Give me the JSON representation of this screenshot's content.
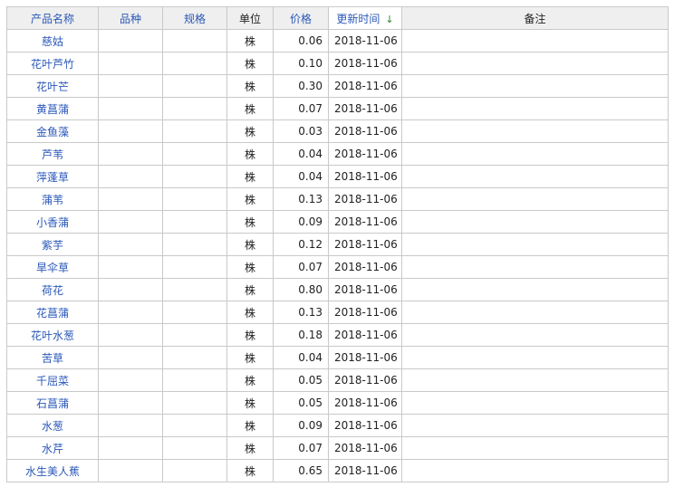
{
  "columns": {
    "name": "产品名称",
    "variety": "品种",
    "spec": "规格",
    "unit": "单位",
    "price": "价格",
    "updated": "更新时间",
    "note": "备注"
  },
  "sort_icon": "arrow-down-icon",
  "rows": [
    {
      "name": "慈姑",
      "variety": "",
      "spec": "",
      "unit": "株",
      "price": "0.06",
      "updated": "2018-11-06",
      "note": ""
    },
    {
      "name": "花叶芦竹",
      "variety": "",
      "spec": "",
      "unit": "株",
      "price": "0.10",
      "updated": "2018-11-06",
      "note": ""
    },
    {
      "name": "花叶芒",
      "variety": "",
      "spec": "",
      "unit": "株",
      "price": "0.30",
      "updated": "2018-11-06",
      "note": ""
    },
    {
      "name": "黄菖蒲",
      "variety": "",
      "spec": "",
      "unit": "株",
      "price": "0.07",
      "updated": "2018-11-06",
      "note": ""
    },
    {
      "name": "金鱼藻",
      "variety": "",
      "spec": "",
      "unit": "株",
      "price": "0.03",
      "updated": "2018-11-06",
      "note": ""
    },
    {
      "name": "芦苇",
      "variety": "",
      "spec": "",
      "unit": "株",
      "price": "0.04",
      "updated": "2018-11-06",
      "note": ""
    },
    {
      "name": "萍蓬草",
      "variety": "",
      "spec": "",
      "unit": "株",
      "price": "0.04",
      "updated": "2018-11-06",
      "note": ""
    },
    {
      "name": "蒲苇",
      "variety": "",
      "spec": "",
      "unit": "株",
      "price": "0.13",
      "updated": "2018-11-06",
      "note": ""
    },
    {
      "name": "小香蒲",
      "variety": "",
      "spec": "",
      "unit": "株",
      "price": "0.09",
      "updated": "2018-11-06",
      "note": ""
    },
    {
      "name": "紫芋",
      "variety": "",
      "spec": "",
      "unit": "株",
      "price": "0.12",
      "updated": "2018-11-06",
      "note": ""
    },
    {
      "name": "旱伞草",
      "variety": "",
      "spec": "",
      "unit": "株",
      "price": "0.07",
      "updated": "2018-11-06",
      "note": ""
    },
    {
      "name": "荷花",
      "variety": "",
      "spec": "",
      "unit": "株",
      "price": "0.80",
      "updated": "2018-11-06",
      "note": ""
    },
    {
      "name": "花菖蒲",
      "variety": "",
      "spec": "",
      "unit": "株",
      "price": "0.13",
      "updated": "2018-11-06",
      "note": ""
    },
    {
      "name": "花叶水葱",
      "variety": "",
      "spec": "",
      "unit": "株",
      "price": "0.18",
      "updated": "2018-11-06",
      "note": ""
    },
    {
      "name": "苦草",
      "variety": "",
      "spec": "",
      "unit": "株",
      "price": "0.04",
      "updated": "2018-11-06",
      "note": ""
    },
    {
      "name": "千屈菜",
      "variety": "",
      "spec": "",
      "unit": "株",
      "price": "0.05",
      "updated": "2018-11-06",
      "note": ""
    },
    {
      "name": "石菖蒲",
      "variety": "",
      "spec": "",
      "unit": "株",
      "price": "0.05",
      "updated": "2018-11-06",
      "note": ""
    },
    {
      "name": "水葱",
      "variety": "",
      "spec": "",
      "unit": "株",
      "price": "0.09",
      "updated": "2018-11-06",
      "note": ""
    },
    {
      "name": "水芹",
      "variety": "",
      "spec": "",
      "unit": "株",
      "price": "0.07",
      "updated": "2018-11-06",
      "note": ""
    },
    {
      "name": "水生美人蕉",
      "variety": "",
      "spec": "",
      "unit": "株",
      "price": "0.65",
      "updated": "2018-11-06",
      "note": ""
    }
  ]
}
